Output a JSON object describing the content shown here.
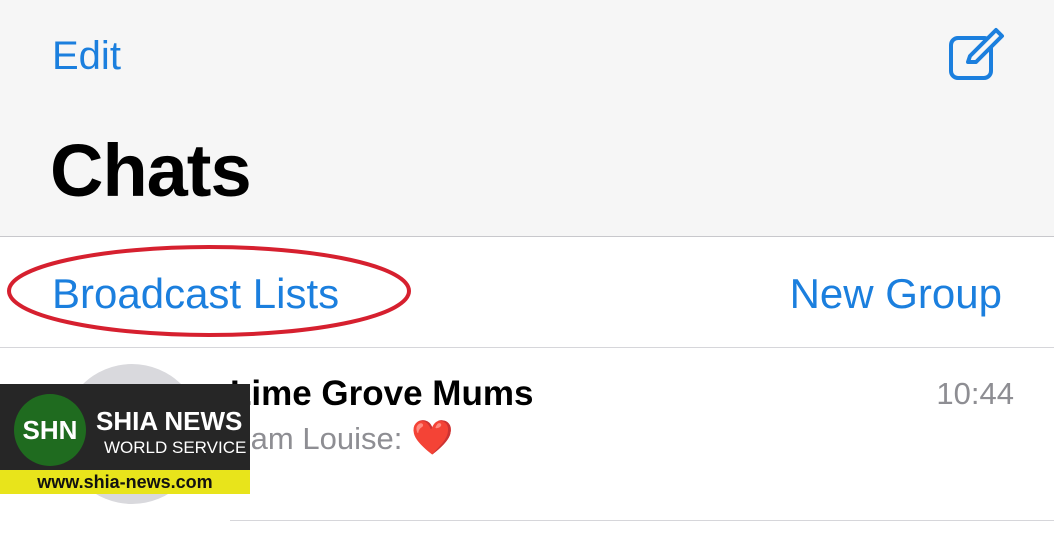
{
  "header": {
    "edit_label": "Edit",
    "compose_icon": "compose-icon",
    "title": "Chats"
  },
  "actions": {
    "broadcast_label": "Broadcast Lists",
    "new_group_label": "New Group",
    "highlight_color": "#d6202f"
  },
  "chats": [
    {
      "name": "Lime Grove Mums",
      "time": "10:44",
      "sender": "Sam Louise:",
      "message_emoji": "❤️"
    }
  ],
  "watermark": {
    "badge": "SHN",
    "name": "SHIA NEWS",
    "service": "WORLD SERVICE",
    "url": "www.shia-news.com"
  },
  "colors": {
    "accent": "#1b7fde",
    "header_bg": "#f6f6f6",
    "secondary_text": "#8e8e93"
  }
}
